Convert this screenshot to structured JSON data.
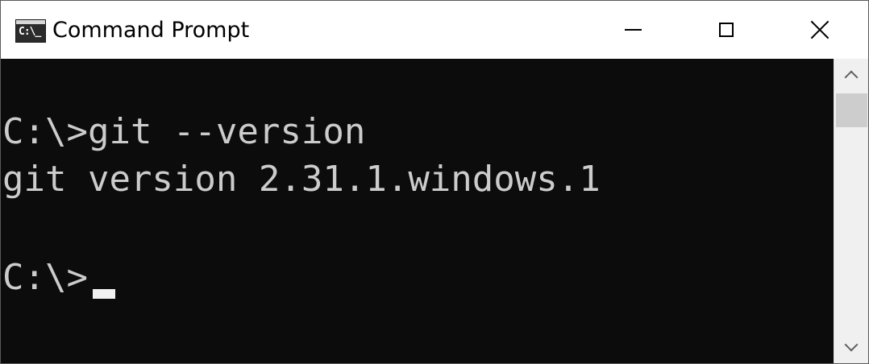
{
  "window": {
    "title": "Command Prompt",
    "icon_label": "C:\\_",
    "icon": "command-prompt-icon",
    "controls": {
      "minimize": "minimize-icon",
      "maximize": "maximize-icon",
      "close": "close-icon"
    }
  },
  "console": {
    "lines": [
      "C:\\>git --version",
      "git version 2.31.1.windows.1",
      "C:\\>"
    ],
    "background": "#0c0c0c",
    "foreground": "#cccccc"
  },
  "scrollbar": {
    "up_icon": "chevron-up-icon",
    "down_icon": "chevron-down-icon"
  }
}
